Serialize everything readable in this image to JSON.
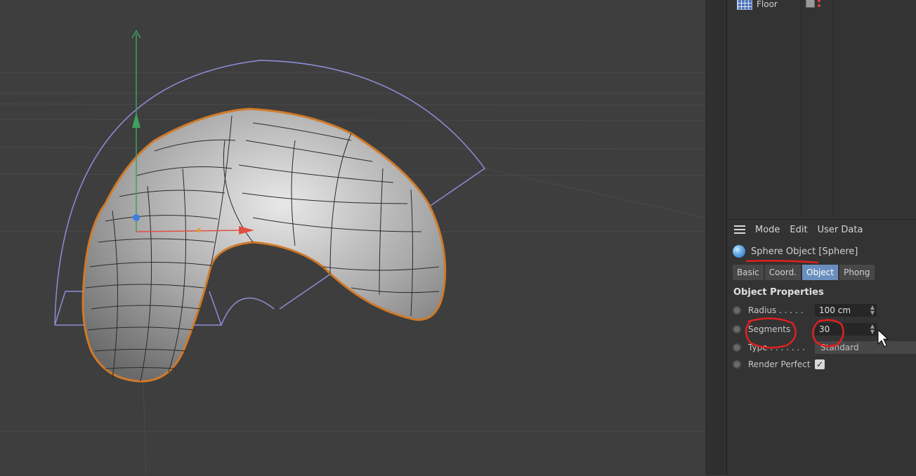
{
  "object_manager": {
    "rows": [
      {
        "name": "Floor",
        "icon": "floor-icon"
      }
    ]
  },
  "attribute_manager": {
    "menu": {
      "mode": "Mode",
      "edit": "Edit",
      "user_data": "User Data"
    },
    "object_header": "Sphere Object [Sphere]",
    "tabs": [
      {
        "label": "Basic",
        "active": false
      },
      {
        "label": "Coord.",
        "active": false
      },
      {
        "label": "Object",
        "active": true
      },
      {
        "label": "Phong",
        "active": false
      }
    ],
    "section_title": "Object Properties",
    "properties": {
      "radius": {
        "label": "Radius . . . . .",
        "value": "100 cm"
      },
      "segments": {
        "label": "Segments",
        "value": "30"
      },
      "type": {
        "label": "Type . . . . . . .",
        "value": "Standard"
      },
      "render_perfect": {
        "label": "Render Perfect",
        "checked": true
      }
    }
  },
  "colors": {
    "viewport_bg": "#3e3e3e",
    "selection_outline": "#d07a2a",
    "deformer_cage": "#8d8dd8",
    "annotation_red": "#e02020",
    "active_tab": "#6a8fbf"
  }
}
